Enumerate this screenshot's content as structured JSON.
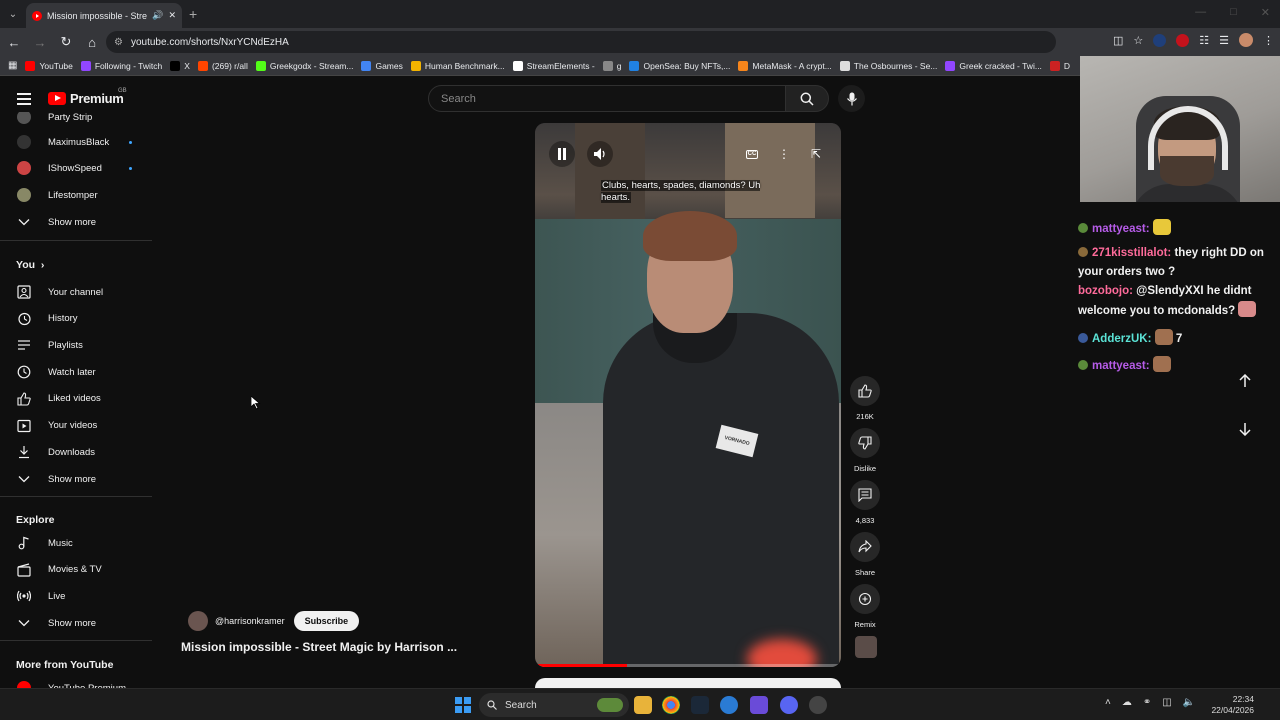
{
  "browser": {
    "tab_title": "Mission impossible - Street",
    "url": "youtube.com/shorts/NxrYCNdEzHA",
    "bookmarks": [
      {
        "label": "YouTube",
        "color": "#ff0000"
      },
      {
        "label": "Following - Twitch",
        "color": "#9146ff"
      },
      {
        "label": "X",
        "color": "#000000"
      },
      {
        "label": "(269) r/all",
        "color": "#ff4500"
      },
      {
        "label": "Greekgodx - Stream...",
        "color": "#53fc18"
      },
      {
        "label": "Games",
        "color": "#4285f4"
      },
      {
        "label": "Human Benchmark...",
        "color": "#f4b400"
      },
      {
        "label": "StreamElements -",
        "color": "#ffffff"
      },
      {
        "label": "g",
        "color": "#888888"
      },
      {
        "label": "OpenSea: Buy NFTs,...",
        "color": "#2081e2"
      },
      {
        "label": "MetaMask - A crypt...",
        "color": "#f6851b"
      },
      {
        "label": "The Osbournes - Se...",
        "color": "#dddddd"
      },
      {
        "label": "Greek cracked - Twi...",
        "color": "#9146ff"
      },
      {
        "label": "D",
        "color": "#cc2222"
      }
    ]
  },
  "youtube": {
    "logo_word": "Premium",
    "logo_region": "GB",
    "search_placeholder": "Search",
    "sidebar": {
      "subscriptions": [
        {
          "label": "Party Strip",
          "color": "#555"
        },
        {
          "label": "MaximusBlack",
          "color": "#333"
        },
        {
          "label": "IShowSpeed",
          "color": "#c44"
        },
        {
          "label": "Lifestomper",
          "color": "#886"
        }
      ],
      "show_more_1": "Show more",
      "you_heading": "You",
      "you_items": [
        "Your channel",
        "History",
        "Playlists",
        "Watch later",
        "Liked videos",
        "Your videos",
        "Downloads"
      ],
      "show_more_2": "Show more",
      "explore_heading": "Explore",
      "explore_items": [
        "Music",
        "Movies & TV",
        "Live"
      ],
      "show_more_3": "Show more",
      "more_heading": "More from YouTube",
      "more_item": "YouTube Premium"
    },
    "short": {
      "caption": "Clubs, hearts, spades, diamonds? Uh hearts.",
      "patch_text": "VORNADO",
      "progress": 0.3,
      "likes": "216K",
      "dislike_label": "Dislike",
      "comments": "4,833",
      "share_label": "Share",
      "remix_label": "Remix",
      "channel_handle": "@harrisonkramer",
      "subscribe_label": "Subscribe",
      "title": "Mission impossible - Street Magic by Harrison ..."
    }
  },
  "stream_chat": [
    {
      "user": "mattyeast:",
      "user_color": "#b65ce8",
      "message": ""
    },
    {
      "user": "271kisstillalot:",
      "user_color": "#ff6b9b",
      "message": "they right DD on your orders two ?"
    },
    {
      "user": "bozobojo:",
      "user_color": "#ff6b9b",
      "message": "@SlendyXXI he didnt welcome you to mcdonalds?"
    },
    {
      "user": "AdderzUK:",
      "user_color": "#5be3d6",
      "message": "7"
    },
    {
      "user": "mattyeast:",
      "user_color": "#b65ce8",
      "message": ""
    }
  ],
  "taskbar": {
    "search_label": "Search",
    "time": "22:34",
    "date": "22/04/2026"
  }
}
